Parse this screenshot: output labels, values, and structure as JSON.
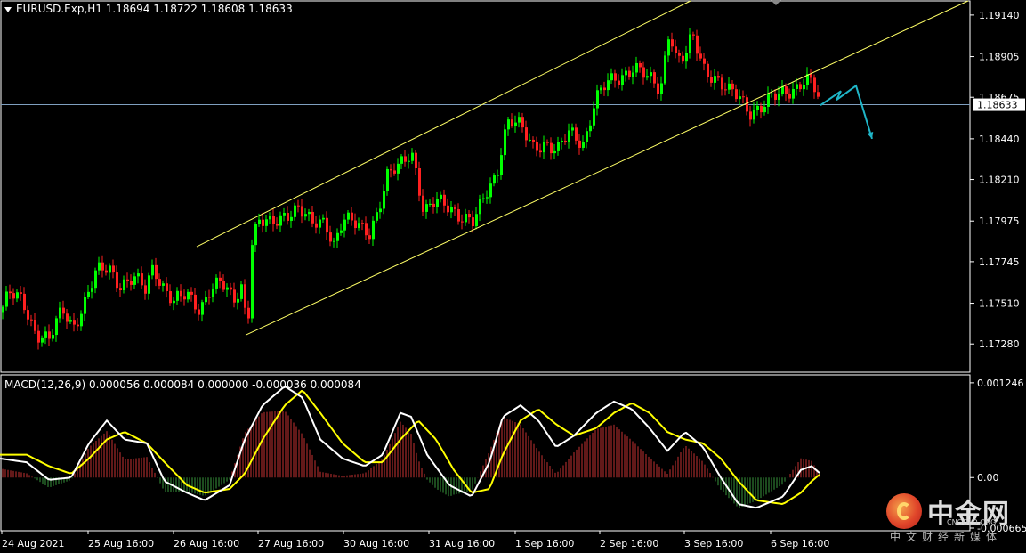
{
  "header": {
    "symbol": "EURUSD.Exp,H1",
    "ohlc": "1.18694 1.18722 1.18608 1.18633"
  },
  "macd_header": {
    "label": "MACD(12,26,9) 0.000056 0.000084 0.000000 -0.000036 0.000084"
  },
  "watermark": {
    "name": "中金网",
    "site": "CNGOLD.ORG",
    "tagline": "中文财经新媒体"
  },
  "colors": {
    "background": "#000000",
    "bull": "#00ff00",
    "bear": "#ff2020",
    "channel": "#ffff66",
    "macd_line": "#ffffff",
    "signal_line": "#ffff00",
    "hist_pos": "#a52a2a",
    "hist_neg": "#2e7d32",
    "arrow": "#1fb5c7",
    "price_line": "#7f9fbf",
    "axis": "#ffffff"
  },
  "chart_data": [
    {
      "type": "candlestick",
      "title": "EURUSD.Exp,H1",
      "ylim": [
        1.1712,
        1.1922
      ],
      "yticks": [
        "1.19140",
        "1.18905",
        "1.18675",
        "1.18440",
        "1.18210",
        "1.17975",
        "1.17745",
        "1.17510",
        "1.17280"
      ],
      "current_price": "1.18633",
      "xticks": [
        "24 Aug 2021",
        "25 Aug 16:00",
        "26 Aug 16:00",
        "27 Aug 16:00",
        "30 Aug 16:00",
        "31 Aug 16:00",
        "1 Sep 16:00",
        "2 Sep 16:00",
        "3 Sep 16:00",
        "6 Sep 16:00"
      ],
      "close_path": [
        [
          0,
          1.1746
        ],
        [
          10,
          1.1756
        ],
        [
          25,
          1.1752
        ],
        [
          40,
          1.1735
        ],
        [
          55,
          1.173
        ],
        [
          70,
          1.1747
        ],
        [
          82,
          1.1738
        ],
        [
          95,
          1.1752
        ],
        [
          108,
          1.1768
        ],
        [
          122,
          1.1771
        ],
        [
          135,
          1.1762
        ],
        [
          150,
          1.1765
        ],
        [
          163,
          1.1758
        ],
        [
          172,
          1.1772
        ],
        [
          182,
          1.1762
        ],
        [
          195,
          1.1752
        ],
        [
          210,
          1.1755
        ],
        [
          224,
          1.1748
        ],
        [
          236,
          1.176
        ],
        [
          248,
          1.1762
        ],
        [
          262,
          1.1752
        ],
        [
          272,
          1.1762
        ],
        [
          278,
          1.1735
        ],
        [
          282,
          1.1785
        ],
        [
          290,
          1.1797
        ],
        [
          305,
          1.1795
        ],
        [
          320,
          1.1802
        ],
        [
          335,
          1.1805
        ],
        [
          350,
          1.1795
        ],
        [
          365,
          1.1798
        ],
        [
          375,
          1.1785
        ],
        [
          385,
          1.1798
        ],
        [
          400,
          1.1795
        ],
        [
          415,
          1.1792
        ],
        [
          425,
          1.1805
        ],
        [
          435,
          1.1822
        ],
        [
          448,
          1.1828
        ],
        [
          462,
          1.1838
        ],
        [
          468,
          1.1825
        ],
        [
          476,
          1.1802
        ],
        [
          490,
          1.1808
        ],
        [
          505,
          1.1806
        ],
        [
          520,
          1.18
        ],
        [
          532,
          1.1796
        ],
        [
          545,
          1.1812
        ],
        [
          558,
          1.1825
        ],
        [
          565,
          1.1845
        ],
        [
          572,
          1.1855
        ],
        [
          585,
          1.185
        ],
        [
          598,
          1.184
        ],
        [
          612,
          1.1842
        ],
        [
          626,
          1.1836
        ],
        [
          640,
          1.1848
        ],
        [
          656,
          1.1842
        ],
        [
          668,
          1.1865
        ],
        [
          682,
          1.1875
        ],
        [
          698,
          1.188
        ],
        [
          712,
          1.1885
        ],
        [
          727,
          1.1878
        ],
        [
          742,
          1.1872
        ],
        [
          752,
          1.1908
        ],
        [
          760,
          1.1888
        ],
        [
          770,
          1.189
        ],
        [
          778,
          1.1902
        ],
        [
          790,
          1.1885
        ],
        [
          805,
          1.1878
        ],
        [
          818,
          1.187
        ],
        [
          830,
          1.1868
        ],
        [
          842,
          1.186
        ],
        [
          855,
          1.1862
        ],
        [
          866,
          1.1866
        ],
        [
          880,
          1.187
        ],
        [
          895,
          1.1874
        ],
        [
          905,
          1.1878
        ],
        [
          913,
          1.1874
        ],
        [
          922,
          1.1863
        ]
      ],
      "channel": {
        "upper": [
          [
            221,
            1.1783
          ],
          [
            776,
            1.1922
          ]
        ],
        "lower": [
          [
            276,
            1.1733
          ],
          [
            1088,
            1.1922
          ]
        ]
      },
      "forecast_arrow": [
        [
          922,
          1.1863
        ],
        [
          945,
          1.1871
        ],
        [
          940,
          1.1866
        ],
        [
          962,
          1.1874
        ],
        [
          980,
          1.1844
        ]
      ]
    },
    {
      "type": "macd",
      "title": "MACD(12,26,9)",
      "ylim": [
        -0.0007,
        0.00135
      ],
      "yticks": [
        "0.001246",
        "0.00",
        "-0.000665"
      ],
      "macd_line": [
        [
          0,
          0.00025
        ],
        [
          30,
          0.0002
        ],
        [
          55,
          -3e-05
        ],
        [
          80,
          0.0
        ],
        [
          100,
          0.00045
        ],
        [
          120,
          0.00075
        ],
        [
          140,
          0.0005
        ],
        [
          165,
          0.00045
        ],
        [
          185,
          -5e-05
        ],
        [
          210,
          -0.0002
        ],
        [
          230,
          -0.0003
        ],
        [
          258,
          -0.0001
        ],
        [
          275,
          0.0005
        ],
        [
          295,
          0.00095
        ],
        [
          320,
          0.0012
        ],
        [
          340,
          0.00105
        ],
        [
          360,
          0.0005
        ],
        [
          385,
          0.00025
        ],
        [
          410,
          0.00015
        ],
        [
          430,
          0.0003
        ],
        [
          450,
          0.00085
        ],
        [
          462,
          0.0008
        ],
        [
          480,
          0.0003
        ],
        [
          505,
          -0.0001
        ],
        [
          530,
          -0.00025
        ],
        [
          550,
          0.0002
        ],
        [
          565,
          0.0008
        ],
        [
          585,
          0.00095
        ],
        [
          605,
          0.00075
        ],
        [
          625,
          0.0004
        ],
        [
          645,
          0.00055
        ],
        [
          670,
          0.00085
        ],
        [
          690,
          0.001
        ],
        [
          710,
          0.0009
        ],
        [
          730,
          0.00065
        ],
        [
          750,
          0.00035
        ],
        [
          770,
          0.0006
        ],
        [
          790,
          0.0004
        ],
        [
          810,
          0.0
        ],
        [
          830,
          -0.00035
        ],
        [
          850,
          -0.0004
        ],
        [
          880,
          -0.00025
        ],
        [
          900,
          0.0001
        ],
        [
          912,
          0.00015
        ],
        [
          922,
          5e-05
        ]
      ],
      "signal_line": [
        [
          0,
          0.0003
        ],
        [
          30,
          0.0003
        ],
        [
          55,
          0.00015
        ],
        [
          80,
          5e-05
        ],
        [
          100,
          0.00025
        ],
        [
          120,
          0.0005
        ],
        [
          140,
          0.0006
        ],
        [
          165,
          0.00045
        ],
        [
          185,
          0.0002
        ],
        [
          210,
          -0.0001
        ],
        [
          230,
          -0.0002
        ],
        [
          258,
          -0.00015
        ],
        [
          275,
          5e-05
        ],
        [
          295,
          0.0005
        ],
        [
          320,
          0.00095
        ],
        [
          340,
          0.00115
        ],
        [
          360,
          0.00085
        ],
        [
          385,
          0.00045
        ],
        [
          410,
          0.0002
        ],
        [
          430,
          0.0002
        ],
        [
          450,
          0.0005
        ],
        [
          470,
          0.00075
        ],
        [
          490,
          0.0005
        ],
        [
          510,
          0.0001
        ],
        [
          530,
          -0.0002
        ],
        [
          550,
          -0.00015
        ],
        [
          565,
          0.0003
        ],
        [
          585,
          0.00075
        ],
        [
          605,
          0.0009
        ],
        [
          625,
          0.0007
        ],
        [
          645,
          0.00055
        ],
        [
          670,
          0.00065
        ],
        [
          690,
          0.00085
        ],
        [
          710,
          0.00098
        ],
        [
          730,
          0.00085
        ],
        [
          750,
          0.0006
        ],
        [
          770,
          0.0005
        ],
        [
          790,
          0.00045
        ],
        [
          810,
          0.00025
        ],
        [
          830,
          -5e-05
        ],
        [
          850,
          -0.0003
        ],
        [
          880,
          -0.00035
        ],
        [
          900,
          -0.0002
        ],
        [
          912,
          -5e-05
        ],
        [
          922,
          5e-05
        ]
      ]
    }
  ]
}
